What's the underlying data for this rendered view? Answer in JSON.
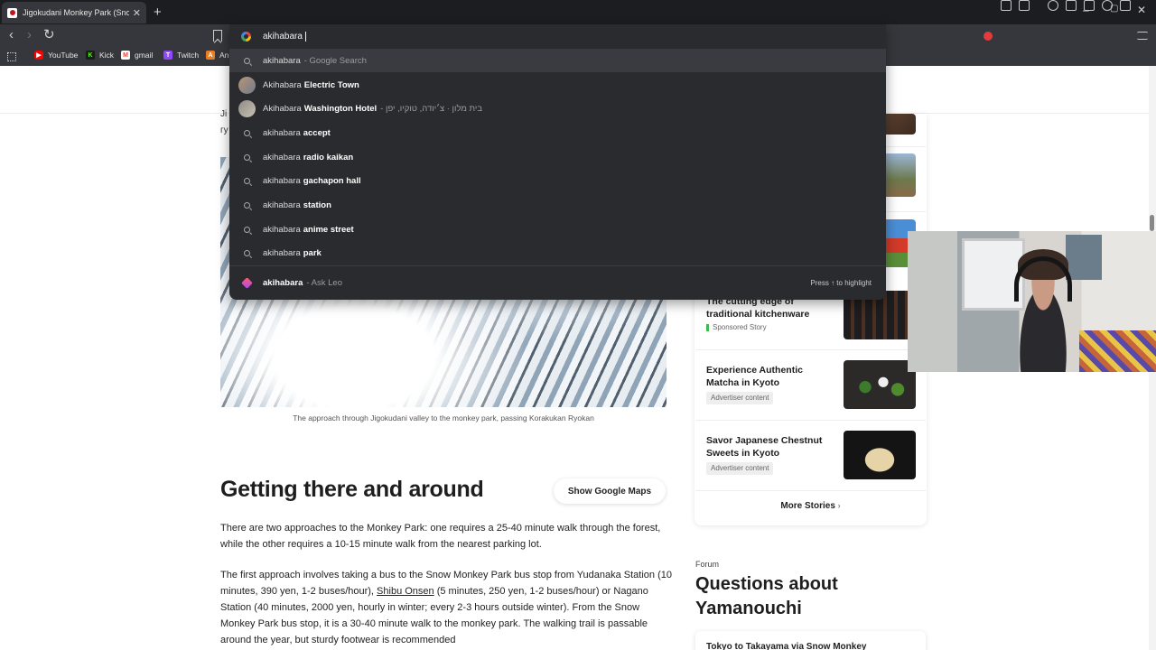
{
  "tab": {
    "title": "Jigokudani Monkey Park (Snow M",
    "close": "✕"
  },
  "window": {
    "new_tab": "+",
    "minimize": "–",
    "maximize": "▢",
    "close": "✕"
  },
  "nav": {
    "back": "‹",
    "forward": "›",
    "reload": "↻"
  },
  "omnibox": {
    "value": "akihabara",
    "suggestions": [
      {
        "prefix": "akihabara",
        "bold": "",
        "suffix": "- Google Search",
        "icon": "search-icon"
      },
      {
        "prefix": "Akihabara",
        "bold": "Electric Town",
        "suffix": "",
        "icon": "place-thumbnail"
      },
      {
        "prefix": "Akihabara",
        "bold": "Washington Hotel",
        "suffix": "- בית מלון · צ׳יודה, טוקיו, יפן",
        "icon": "place-thumbnail"
      },
      {
        "prefix": "akihabara",
        "bold": "accept",
        "suffix": "",
        "icon": "search-icon"
      },
      {
        "prefix": "akihabara",
        "bold": "radio kaikan",
        "suffix": "",
        "icon": "search-icon"
      },
      {
        "prefix": "akihabara",
        "bold": "gachapon hall",
        "suffix": "",
        "icon": "search-icon"
      },
      {
        "prefix": "akihabara",
        "bold": "station",
        "suffix": "",
        "icon": "search-icon"
      },
      {
        "prefix": "akihabara",
        "bold": "anime street",
        "suffix": "",
        "icon": "search-icon"
      },
      {
        "prefix": "akihabara",
        "bold": "park",
        "suffix": "",
        "icon": "search-icon"
      }
    ],
    "leo": {
      "bold": "akihabara",
      "suffix": "- Ask Leo",
      "hint": "Press ↑ to highlight"
    }
  },
  "bookmarks": [
    {
      "label": "YouTube",
      "color": "#ff0000",
      "glyph": "▶"
    },
    {
      "label": "Kick",
      "color": "#53fc18",
      "glyph": "K"
    },
    {
      "label": "gmail",
      "color": "#ea4335",
      "glyph": "M"
    },
    {
      "label": "Twitch",
      "color": "#9146ff",
      "glyph": "T"
    },
    {
      "label": "An",
      "color": "#e67e22",
      "glyph": "A"
    }
  ],
  "page": {
    "left_fragment_1": "Ji",
    "left_fragment_2": "гу",
    "photo_caption": "The approach through Jigokudani valley to the monkey park, passing Korakukan Ryokan",
    "section_title": "Getting there and around",
    "maps_button": "Show Google Maps",
    "para1": "There are two approaches to the Monkey Park: one requires a 25-40 minute walk through the forest, while the other requires a 10-15 minute walk from the nearest parking lot.",
    "para2_a": "The first approach involves taking a bus to the Snow Monkey Park bus stop from Yudanaka Station (10 minutes, 390 yen, 1-2 buses/hour), ",
    "para2_link": "Shibu Onsen",
    "para2_b": " (5 minutes, 250 yen, 1-2 buses/hour) or Nagano Station (40 minutes, 2000 yen, hourly in winter; every 2-3 hours outside winter). From the Snow Monkey Park bus stop, it is a 30-40 minute walk to the monkey park. The walking trail is passable around the year, but sturdy footwear is recommended"
  },
  "sidebar": {
    "stories": [
      {
        "title": "The cutting edge of traditional kitchenware",
        "tag": "Sponsored Story",
        "tag_type": "sponsored"
      },
      {
        "title": "Experience Authentic Matcha in Kyoto",
        "tag": "Advertiser content",
        "tag_type": "advertiser"
      },
      {
        "title": "Savor Japanese Chestnut Sweets in Kyoto",
        "tag": "Advertiser content",
        "tag_type": "advertiser"
      }
    ],
    "more": "More Stories",
    "more_chevron": "›",
    "forum_label": "Forum",
    "forum_title": "Questions about Yamanouchi",
    "forum_card": "Tokyo to Takayama via Snow Monkey"
  }
}
